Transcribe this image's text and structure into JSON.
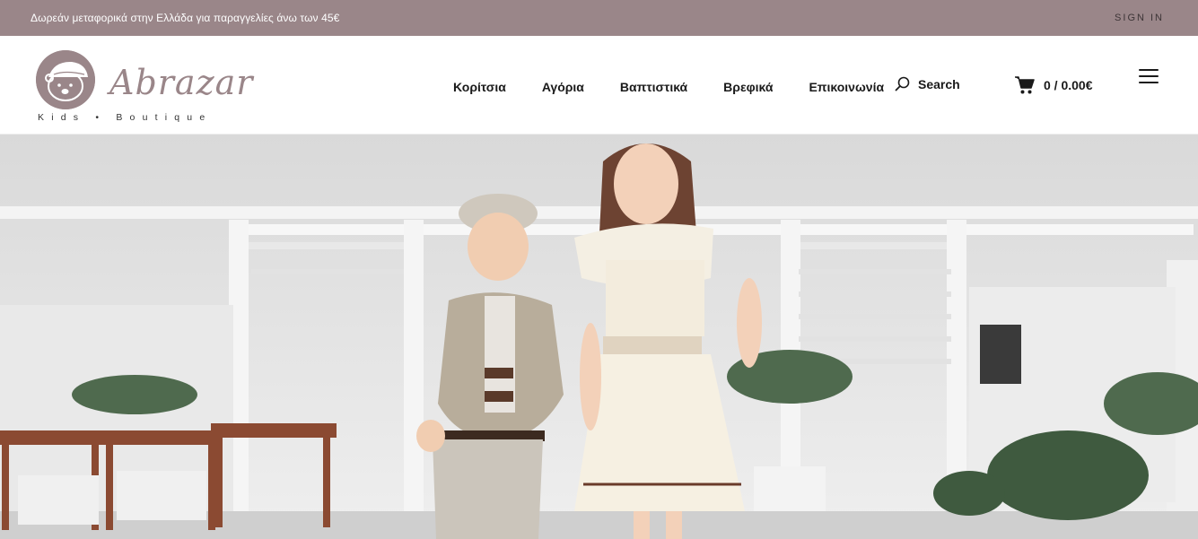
{
  "topbar": {
    "promo": "Δωρεάν μεταφορικά στην Ελλάδα για παραγγελίες άνω των 45€",
    "signin": "SIGN IN",
    "bg_color": "#9a8689"
  },
  "logo": {
    "name": "Abrazar",
    "tagline": "Kids • Boutique",
    "icon": "bear-cap-icon"
  },
  "nav": {
    "items": [
      {
        "label": "Κορίτσια"
      },
      {
        "label": "Αγόρια"
      },
      {
        "label": "Βαπτιστικά"
      },
      {
        "label": "Βρεφικά"
      },
      {
        "label": "Επικοινωνία"
      }
    ]
  },
  "search": {
    "label": "Search",
    "icon": "search-icon"
  },
  "cart": {
    "label": "0 / 0.00€",
    "icon": "cart-icon"
  },
  "menu": {
    "icon": "hamburger-icon"
  },
  "hero": {
    "image": "two-children-boutique-photo"
  }
}
